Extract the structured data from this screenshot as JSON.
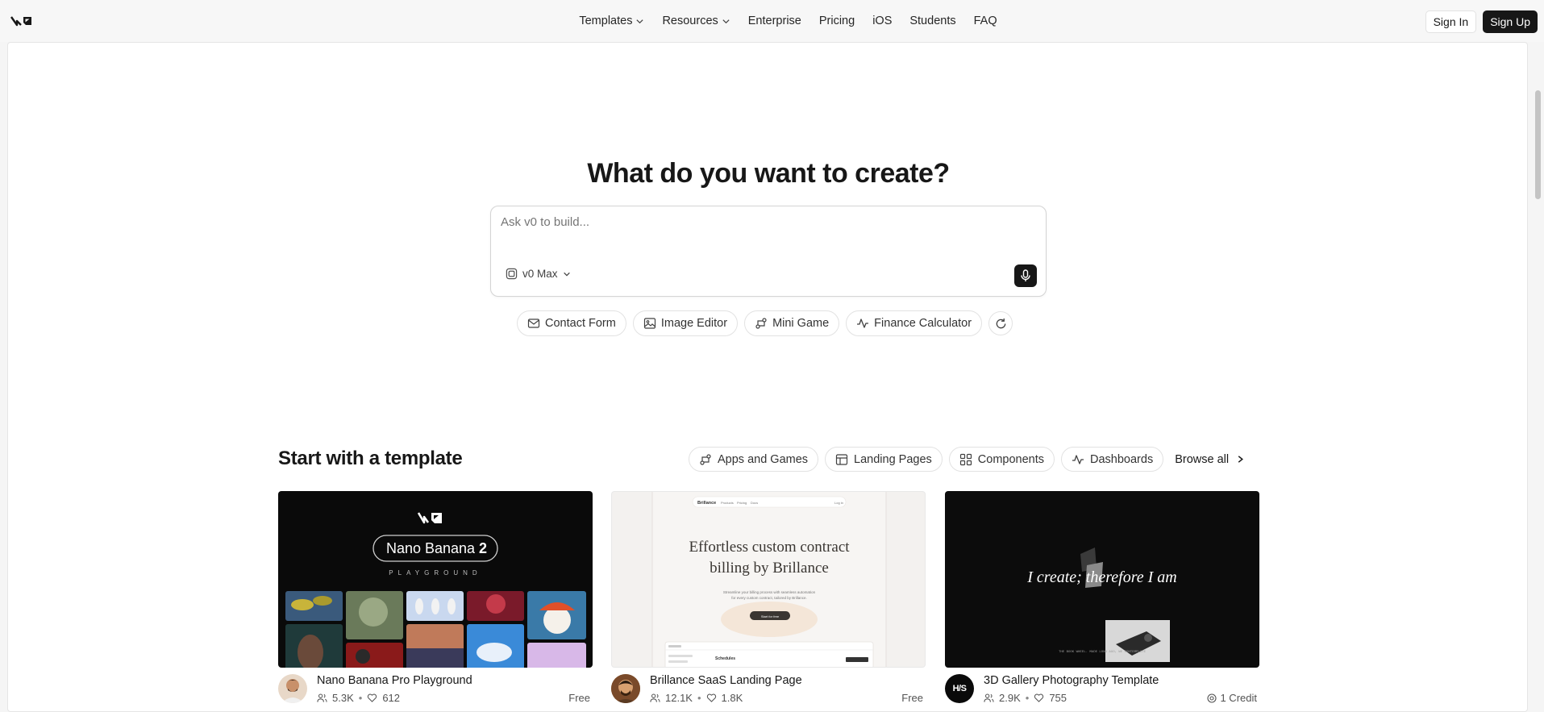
{
  "nav": {
    "items": [
      {
        "label": "Templates",
        "has_dropdown": true
      },
      {
        "label": "Resources",
        "has_dropdown": true
      },
      {
        "label": "Enterprise",
        "has_dropdown": false
      },
      {
        "label": "Pricing",
        "has_dropdown": false
      },
      {
        "label": "iOS",
        "has_dropdown": false
      },
      {
        "label": "Students",
        "has_dropdown": false
      },
      {
        "label": "FAQ",
        "has_dropdown": false
      }
    ],
    "sign_in": "Sign In",
    "sign_up": "Sign Up"
  },
  "hero": {
    "title": "What do you want to create?",
    "prompt_placeholder": "Ask v0 to build...",
    "model": "v0 Max"
  },
  "suggestions": [
    {
      "label": "Contact Form",
      "icon": "mail-icon"
    },
    {
      "label": "Image Editor",
      "icon": "image-icon"
    },
    {
      "label": "Mini Game",
      "icon": "game-icon"
    },
    {
      "label": "Finance Calculator",
      "icon": "activity-icon"
    }
  ],
  "templates": {
    "title": "Start with a template",
    "filters": [
      {
        "label": "Apps and Games",
        "icon": "apps-icon"
      },
      {
        "label": "Landing Pages",
        "icon": "layout-icon"
      },
      {
        "label": "Components",
        "icon": "grid-icon"
      },
      {
        "label": "Dashboards",
        "icon": "activity-icon"
      }
    ],
    "browse_all": "Browse all",
    "cards": [
      {
        "title": "Nano Banana Pro Playground",
        "users": "5.3K",
        "likes": "612",
        "price": "Free",
        "thumb_title": "Nano Banana",
        "thumb_title_num": "2",
        "thumb_sub": "PLAYGROUND",
        "thumb_logo": "v0"
      },
      {
        "title": "Brillance SaaS Landing Page",
        "users": "12.1K",
        "likes": "1.8K",
        "price": "Free",
        "thumb_brand": "Brillance",
        "thumb_nav": [
          "Products",
          "Pricing",
          "Docs"
        ],
        "thumb_login": "Log in",
        "thumb_headline_1": "Effortless custom contract",
        "thumb_headline_2": "billing by Brillance",
        "thumb_sub_1": "Streamline your billing process with seamless automation",
        "thumb_sub_2": "for every custom contract, tailored by Brillance.",
        "thumb_cta": "Start for free",
        "thumb_panel_title": "Schedules"
      },
      {
        "title": "3D Gallery Photography Template",
        "users": "2.9K",
        "likes": "755",
        "price": "1 Credit",
        "avatar_text": "H/S",
        "thumb_headline": "I create; therefore I am",
        "thumb_caption": "THE BOOK WHEEL. MADE LONG AGO, WE CONTEMPLATE"
      }
    ]
  },
  "colors": {
    "dark": "#171717",
    "border": "#e2e2e2",
    "muted": "#525252"
  }
}
